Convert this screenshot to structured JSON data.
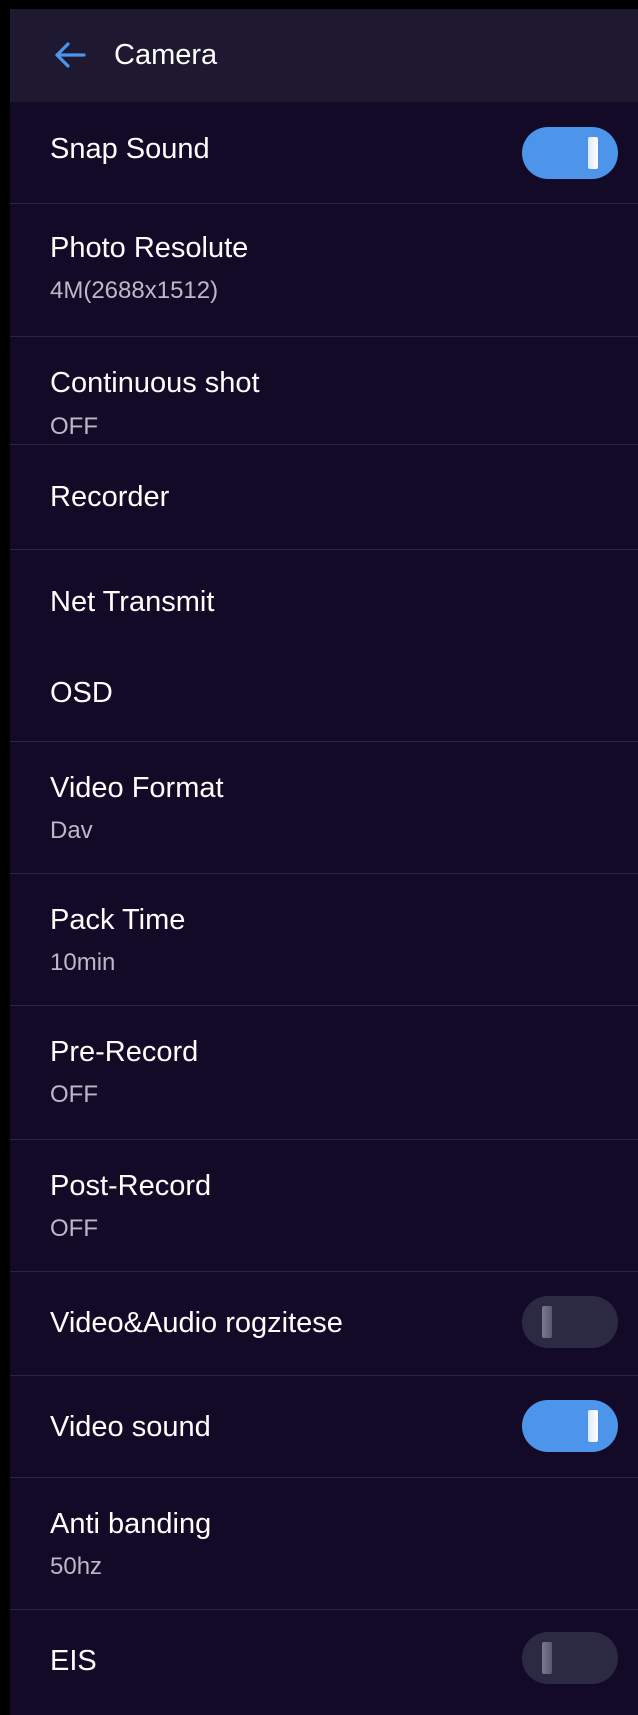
{
  "header": {
    "title": "Camera",
    "back_icon": "arrow-left-icon",
    "accent_color": "#4c95ea"
  },
  "settings": {
    "snap_sound": {
      "label": "Snap Sound",
      "enabled": true
    },
    "photo_resolute": {
      "label": "Photo Resolute",
      "value": "4M(2688x1512)"
    },
    "continuous_shot": {
      "label": "Continuous shot",
      "value": "OFF"
    },
    "recorder": {
      "label": "Recorder"
    },
    "net_transmit": {
      "label": "Net Transmit"
    },
    "osd": {
      "label": "OSD"
    },
    "video_format": {
      "label": "Video Format",
      "value": "Dav"
    },
    "pack_time": {
      "label": "Pack Time",
      "value": "10min"
    },
    "pre_record": {
      "label": "Pre-Record",
      "value": "OFF"
    },
    "post_record": {
      "label": "Post-Record",
      "value": "OFF"
    },
    "video_audio": {
      "label": "Video&Audio rogzitese",
      "enabled": false
    },
    "video_sound": {
      "label": "Video sound",
      "enabled": true
    },
    "anti_banding": {
      "label": "Anti banding",
      "value": "50hz"
    },
    "eis": {
      "label": "EIS",
      "enabled": false
    }
  },
  "colors": {
    "background": "#120a26",
    "header_background": "#1e1830",
    "toggle_on": "#4c95ea",
    "toggle_off": "#2c2a42"
  }
}
